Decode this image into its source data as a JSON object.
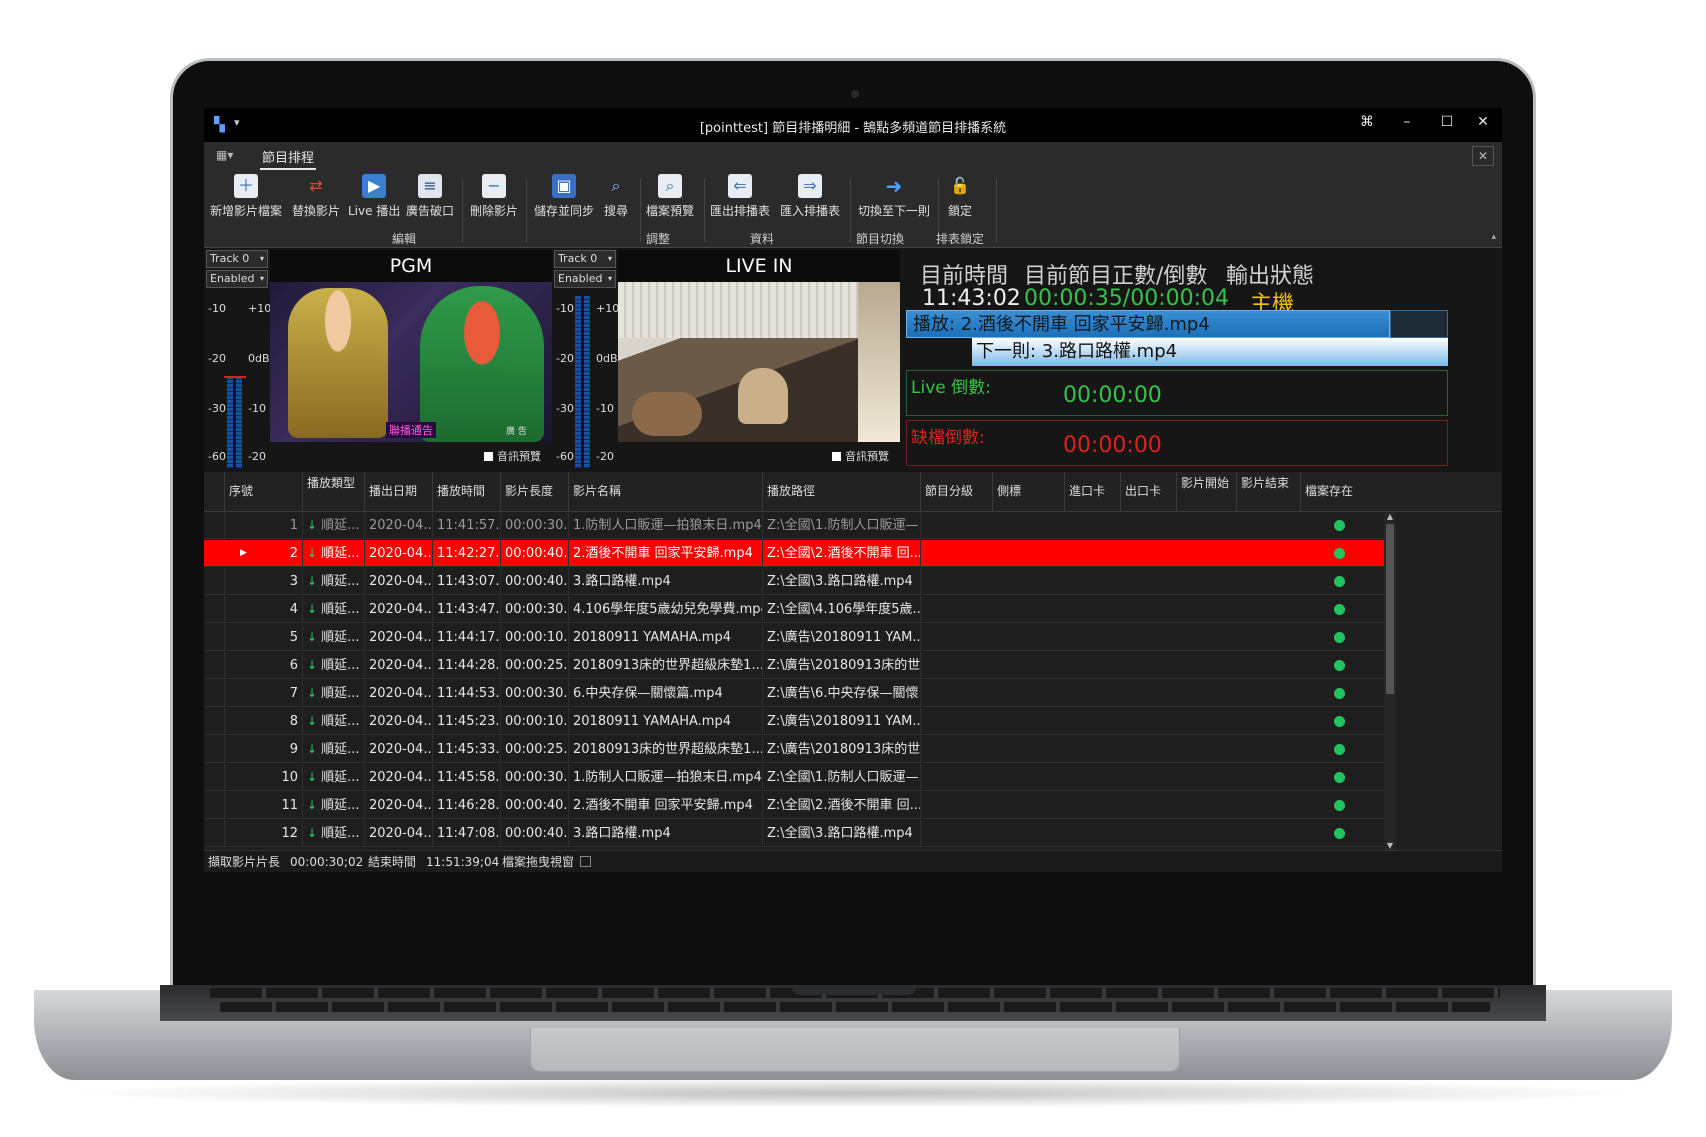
{
  "window": {
    "title": "[pointtest] 節目排播明細 - 鵠點多頻道節目排播系統",
    "minimize": "–",
    "maximize": "☐",
    "close": "✕",
    "extra": "⌘"
  },
  "ribbon_tab": "節目排程",
  "toolbar": {
    "buttons": [
      {
        "label": "新增影片檔案",
        "icon": "add-file-icon"
      },
      {
        "label": "替換影片",
        "icon": "replace-icon"
      },
      {
        "label": "Live 播出",
        "icon": "clapper-icon"
      },
      {
        "label": "廣告破口",
        "icon": "ad-break-icon"
      },
      {
        "label": "刪除影片",
        "icon": "delete-file-icon"
      },
      {
        "label": "儲存並同步",
        "icon": "save-icon"
      },
      {
        "label": "搜尋",
        "icon": "search-icon"
      },
      {
        "label": "檔案預覽",
        "icon": "preview-icon"
      },
      {
        "label": "匯出排播表",
        "icon": "export-icon"
      },
      {
        "label": "匯入排播表",
        "icon": "import-icon"
      },
      {
        "label": "切換至下一則",
        "icon": "next-arrow-icon"
      },
      {
        "label": "鎖定",
        "icon": "lock-icon"
      }
    ],
    "groups": [
      "編輯",
      "調整",
      "資料",
      "節目切換",
      "排表鎖定"
    ]
  },
  "monitors": {
    "pgm": {
      "title": "PGM",
      "track": "Track 0",
      "enabled": "Enabled",
      "audio_preview": "音訊預覽",
      "caption": "聯播通告",
      "corner": "廣 告"
    },
    "live": {
      "title": "LIVE IN",
      "track": "Track 0",
      "enabled": "Enabled",
      "audio_preview": "音訊預覽"
    },
    "meter_left": [
      "-10",
      "-20",
      "-30",
      "-60"
    ],
    "meter_right": [
      "+10",
      "0dB",
      "-10",
      "-20"
    ]
  },
  "status": {
    "head_time": "目前時間",
    "head_count": "目前節目正數/倒數",
    "head_output": "輸出狀態",
    "time": "11:43:02",
    "count": "00:00:35/00:00:04",
    "output": "主機",
    "playing": "播放: 2.酒後不開車  回家平安歸.mp4",
    "next": "下一則: 3.路口路權.mp4",
    "live_label": "Live 倒數:",
    "live_value": "00:00:00",
    "missing_label": "缺檔倒數:",
    "missing_value": "00:00:00",
    "colors": {
      "green": "#38c24a",
      "red": "#e02020",
      "yellow": "#f2c200"
    }
  },
  "grid": {
    "headers": [
      "序號",
      "播放類型",
      "播出日期",
      "播放時間",
      "影片長度",
      "影片名稱",
      "播放路徑",
      "節目分級",
      "側標",
      "進口卡",
      "出口卡",
      "影片開始",
      "影片結束",
      "檔案存在"
    ],
    "rows": [
      {
        "no": "1",
        "type": "順延...",
        "date": "2020-04...",
        "time": "11:41:57...",
        "len": "00:00:30...",
        "name": "1.防制人口販運—拍狼末日.mp4",
        "path": "Z:\\全國\\1.防制人口販運—..."
      },
      {
        "no": "2",
        "type": "順延...",
        "date": "2020-04...",
        "time": "11:42:27...",
        "len": "00:00:40...",
        "name": "2.酒後不開車  回家平安歸.mp4",
        "path": "Z:\\全國\\2.酒後不開車  回..."
      },
      {
        "no": "3",
        "type": "順延...",
        "date": "2020-04...",
        "time": "11:43:07...",
        "len": "00:00:40...",
        "name": "3.路口路權.mp4",
        "path": "Z:\\全國\\3.路口路權.mp4"
      },
      {
        "no": "4",
        "type": "順延...",
        "date": "2020-04...",
        "time": "11:43:47...",
        "len": "00:00:30...",
        "name": "4.106學年度5歲幼兒免學費.mp4",
        "path": "Z:\\全國\\4.106學年度5歲..."
      },
      {
        "no": "5",
        "type": "順延...",
        "date": "2020-04...",
        "time": "11:44:17...",
        "len": "00:00:10...",
        "name": "20180911 YAMAHA.mp4",
        "path": "Z:\\廣告\\20180911 YAM..."
      },
      {
        "no": "6",
        "type": "順延...",
        "date": "2020-04...",
        "time": "11:44:28...",
        "len": "00:00:25...",
        "name": "20180913床的世界超級床墊1...",
        "path": "Z:\\廣告\\20180913床的世..."
      },
      {
        "no": "7",
        "type": "順延...",
        "date": "2020-04...",
        "time": "11:44:53...",
        "len": "00:00:30...",
        "name": "6.中央存保—關懷篇.mp4",
        "path": "Z:\\廣告\\6.中央存保—關懷..."
      },
      {
        "no": "8",
        "type": "順延...",
        "date": "2020-04...",
        "time": "11:45:23...",
        "len": "00:00:10...",
        "name": "20180911 YAMAHA.mp4",
        "path": "Z:\\廣告\\20180911 YAM..."
      },
      {
        "no": "9",
        "type": "順延...",
        "date": "2020-04...",
        "time": "11:45:33...",
        "len": "00:00:25...",
        "name": "20180913床的世界超級床墊1...",
        "path": "Z:\\廣告\\20180913床的世..."
      },
      {
        "no": "10",
        "type": "順延...",
        "date": "2020-04...",
        "time": "11:45:58...",
        "len": "00:00:30...",
        "name": "1.防制人口販運—拍狼末日.mp4",
        "path": "Z:\\全國\\1.防制人口販運—..."
      },
      {
        "no": "11",
        "type": "順延...",
        "date": "2020-04...",
        "time": "11:46:28...",
        "len": "00:00:40...",
        "name": "2.酒後不開車  回家平安歸.mp4",
        "path": "Z:\\全國\\2.酒後不開車  回..."
      },
      {
        "no": "12",
        "type": "順延...",
        "date": "2020-04...",
        "time": "11:47:08...",
        "len": "00:00:40...",
        "name": "3.路口路權.mp4",
        "path": "Z:\\全國\\3.路口路權.mp4"
      }
    ]
  },
  "statusbar": {
    "selected_len_label": "擷取影片片長",
    "selected_len": "00:00:30;02",
    "end_time_label": "結束時間",
    "end_time": "11:51:39;04",
    "file_window_label": "檔案拖曳視窗"
  }
}
